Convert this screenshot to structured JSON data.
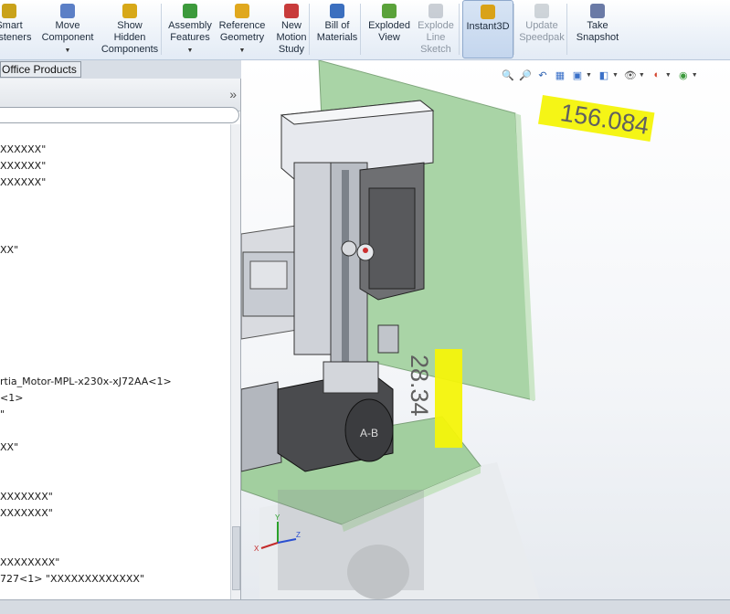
{
  "ribbon": {
    "buttons": [
      {
        "id": "smart-fasteners",
        "label": "Smart\nFasteners",
        "icon": "smart-fasteners-icon"
      },
      {
        "id": "move-component",
        "label": "Move\nComponent",
        "icon": "move-component-icon",
        "dropdown": true
      },
      {
        "id": "show-hidden",
        "label": "Show\nHidden\nComponents",
        "icon": "show-hidden-icon"
      },
      {
        "id": "assembly-features",
        "label": "Assembly\nFeatures",
        "icon": "assembly-features-icon",
        "dropdown": true
      },
      {
        "id": "reference-geometry",
        "label": "Reference\nGeometry",
        "icon": "reference-geometry-icon",
        "dropdown": true
      },
      {
        "id": "new-motion-study",
        "label": "New\nMotion\nStudy",
        "icon": "motion-study-icon"
      },
      {
        "id": "bill-of-materials",
        "label": "Bill of\nMaterials",
        "icon": "bill-of-materials-icon"
      },
      {
        "id": "exploded-view",
        "label": "Exploded\nView",
        "icon": "exploded-view-icon"
      },
      {
        "id": "explode-line-sketch",
        "label": "Explode\nLine\nSketch",
        "icon": "explode-line-sketch-icon",
        "disabled": true
      },
      {
        "id": "instant3d",
        "label": "Instant3D",
        "icon": "instant3d-icon",
        "active": true
      },
      {
        "id": "update-speedpak",
        "label": "Update\nSpeedpak",
        "icon": "speedpak-icon",
        "disabled": true
      },
      {
        "id": "take-snapshot",
        "label": "Take\nSnapshot",
        "icon": "snapshot-icon"
      }
    ]
  },
  "tabs": {
    "office_products": "Office Products"
  },
  "panel": {
    "expand": "»",
    "tree": [
      "XXXXXX\"",
      "XXXXXX\"",
      "XXXXXX\"",
      "XX\"",
      "rtia_Motor-MPL-x230x-xJ72AA<1>",
      "<1>",
      "\"",
      "XX\"",
      "XXXXXXX\"",
      "XXXXXXX\"",
      "XXXXXXXX\"",
      "727<1> \"XXXXXXXXXXXXX\""
    ]
  },
  "headsup": [
    "zoom-to-fit-icon",
    "zoom-to-area-icon",
    "previous-view-icon",
    "section-view-icon",
    "view-orientation-icon",
    "display-style-icon",
    "hide-show-items-icon",
    "edit-appearance-icon",
    "apply-scene-icon"
  ],
  "dimensions": {
    "top": "156.084",
    "side": "28.34"
  },
  "colors": {
    "plate": "#a8d4a6",
    "highlight": "#f4f40a",
    "active": "#c4d6ee"
  }
}
